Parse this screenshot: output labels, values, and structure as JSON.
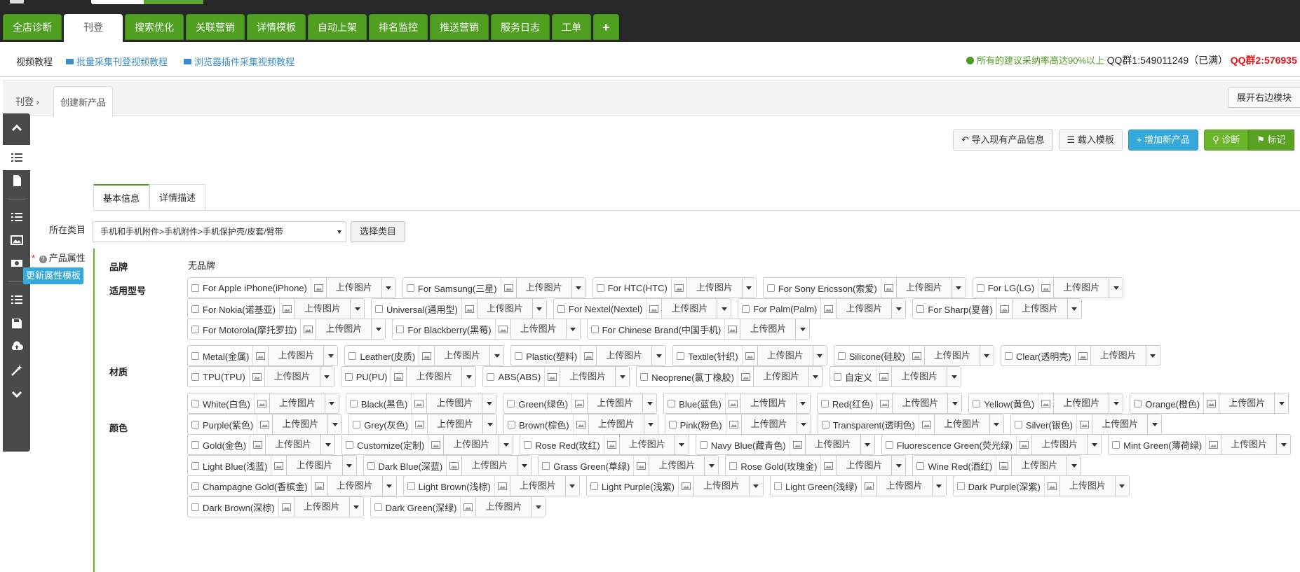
{
  "nav": {
    "tabs": [
      "全店诊断",
      "刊登",
      "搜索优化",
      "关联营销",
      "详情模板",
      "自动上架",
      "排名监控",
      "推送营销",
      "服务日志",
      "工单",
      "+"
    ]
  },
  "subbar": {
    "video_label": "视频教程",
    "link1": "批量采集刊登视频教程",
    "link2": "浏览器插件采集视频教程",
    "note_green": "所有的建议采纳率高达90%以上",
    "qq1": "QQ群1:549011249（已满）",
    "qq2": "QQ群2:576935"
  },
  "crumb": {
    "root": "刊登",
    "tab": "创建新产品",
    "expand": "展开右边模块"
  },
  "toolbar": {
    "import": "导入现有产品信息",
    "load_tpl": "载入模板",
    "add_product": "增加新产品",
    "diagnose": "诊断",
    "mark": "标记"
  },
  "product_tabs": [
    "基本信息",
    "详情描述"
  ],
  "category": {
    "label": "所在类目",
    "value": "手机和手机附件>手机附件>手机保护壳/皮套/臂带",
    "select_button": "选择类目"
  },
  "attributes": {
    "label": "产品属性",
    "required_mark": "*",
    "help_mark": "?",
    "update_template_button": "更新属性模板",
    "upload_label": "上传图片",
    "brand": {
      "label": "品牌",
      "value": "无品牌"
    },
    "models": {
      "label": "适用型号",
      "rows": [
        [
          "For Apple iPhone(iPhone)",
          "For Samsung(三星)",
          "For HTC(HTC)",
          "For Sony Ericsson(索爱)",
          "For LG(LG)"
        ],
        [
          "For Nokia(诺基亚)",
          "Universal(通用型)",
          "For Nextel(Nextel)",
          "For Palm(Palm)",
          "For Sharp(夏普)"
        ],
        [
          "For Motorola(摩托罗拉)",
          "For Blackberry(黑莓)",
          "For Chinese Brand(中国手机)"
        ]
      ]
    },
    "material": {
      "label": "材质",
      "rows": [
        [
          "Metal(金属)",
          "Leather(皮质)",
          "Plastic(塑料)",
          "Textile(针织)",
          "Silicone(硅胶)",
          "Clear(透明壳)"
        ],
        [
          "TPU(TPU)",
          "PU(PU)",
          "ABS(ABS)",
          "Neoprene(氯丁橡胶)",
          "自定义"
        ]
      ]
    },
    "color": {
      "label": "颜色",
      "rows": [
        [
          "White(白色)",
          "Black(黑色)",
          "Green(绿色)",
          "Blue(蓝色)",
          "Red(红色)",
          "Yellow(黄色)",
          "Orange(橙色)"
        ],
        [
          "Purple(紫色)",
          "Grey(灰色)",
          "Brown(棕色)",
          "Pink(粉色)",
          "Transparent(透明色)",
          "Silver(银色)"
        ],
        [
          "Gold(金色)",
          "Customize(定制)",
          "Rose Red(玫红)",
          "Navy Blue(藏青色)",
          "Fluorescence Green(荧光绿)",
          "Mint Green(薄荷绿)"
        ],
        [
          "Light Blue(浅蓝)",
          "Dark Blue(深蓝)",
          "Grass Green(草绿)",
          "Rose Gold(玫瑰金)",
          "Wine Red(酒红)"
        ],
        [
          "Champagne Gold(香槟金)",
          "Light Brown(浅棕)",
          "Light Purple(浅紫)",
          "Light Green(浅绿)",
          "Dark Purple(深紫)"
        ],
        [
          "Dark Brown(深棕)",
          "Dark Green(深绿)"
        ]
      ]
    }
  },
  "colors": {
    "nav_green": "#4fa020",
    "primary_blue": "#35a9dc",
    "alert_red": "#e5141b",
    "topbar": "#272727"
  }
}
